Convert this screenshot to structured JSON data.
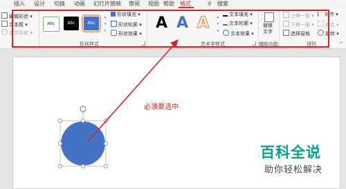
{
  "tabs": [
    {
      "label": "插入"
    },
    {
      "label": "设计"
    },
    {
      "label": "切换"
    },
    {
      "label": "动画"
    },
    {
      "label": "幻灯片放映"
    },
    {
      "label": "审阅"
    },
    {
      "label": "视图"
    },
    {
      "label": "帮助"
    },
    {
      "label": "格式"
    },
    {
      "label": "搜索"
    }
  ],
  "insert_shapes": {
    "edit_shape": "编辑形状",
    "text_box": "文本框",
    "merge_shapes": "合并形状"
  },
  "shape_styles": {
    "swatches": [
      {
        "label": "Abc"
      },
      {
        "label": "Abc"
      },
      {
        "label": "Abc"
      }
    ],
    "fill": "形状填充",
    "outline": "形状轮廓",
    "effects": "形状效果",
    "group_label": "形状样式"
  },
  "wordart": {
    "samples": [
      {
        "letter": "A"
      },
      {
        "letter": "A"
      },
      {
        "letter": "A"
      }
    ],
    "text_fill": "文本填充",
    "text_outline": "文本轮廓",
    "text_effects": "文本效果",
    "group_label": "艺术字样式"
  },
  "accessibility": {
    "alt_text_line1": "替换",
    "alt_text_line2": "文字",
    "group_label": "辅助功能"
  },
  "arrange": {
    "bring_forward": "上移一层",
    "send_backward": "下移一层",
    "selection_pane": "选择窗格",
    "align": "对齐",
    "group": "组合",
    "rotate": "旋转",
    "group_label": "排列"
  },
  "canvas": {
    "annotation": "必须要选中"
  },
  "watermark": {
    "title": "百科全说",
    "subtitle": "助你轻松解决"
  },
  "colors": {
    "accent": "#c0392b",
    "annotation_red": "#e02020",
    "shape_fill": "#4472c4",
    "watermark_green": "#00a48a"
  }
}
